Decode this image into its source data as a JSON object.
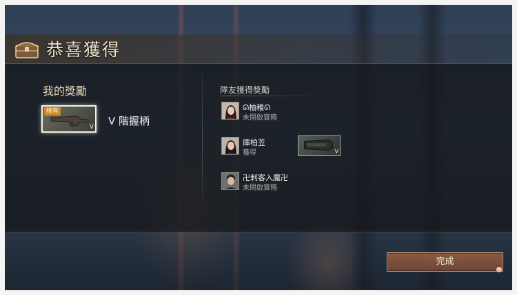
{
  "header": {
    "title": "恭喜獲得",
    "icon": "treasure-chest-icon"
  },
  "my_rewards": {
    "heading": "我的獎勵",
    "item": {
      "rarity": "稀有",
      "tier": "V",
      "name": "V 階握柄",
      "icon": "weapon-grip-icon"
    }
  },
  "team_rewards": {
    "heading": "隊友獲得獎勵",
    "members": [
      {
        "name": "ᘏ柚稚ᘏ",
        "status": "未開啟寶箱",
        "avatar": "female-avatar-icon"
      },
      {
        "name": "庫柏苙",
        "status": "獲得",
        "avatar": "female-avatar-icon",
        "item": {
          "tier": "V",
          "icon": "weapon-stock-icon"
        }
      },
      {
        "name": "卍刺客入魔卍",
        "status": "未開啟寶箱",
        "avatar": "male-avatar-icon"
      }
    ]
  },
  "footer": {
    "confirm_label": "完成"
  },
  "colors": {
    "accent": "#8a5a44",
    "title": "#f1e3c8",
    "rarity": "#c88a2a"
  }
}
